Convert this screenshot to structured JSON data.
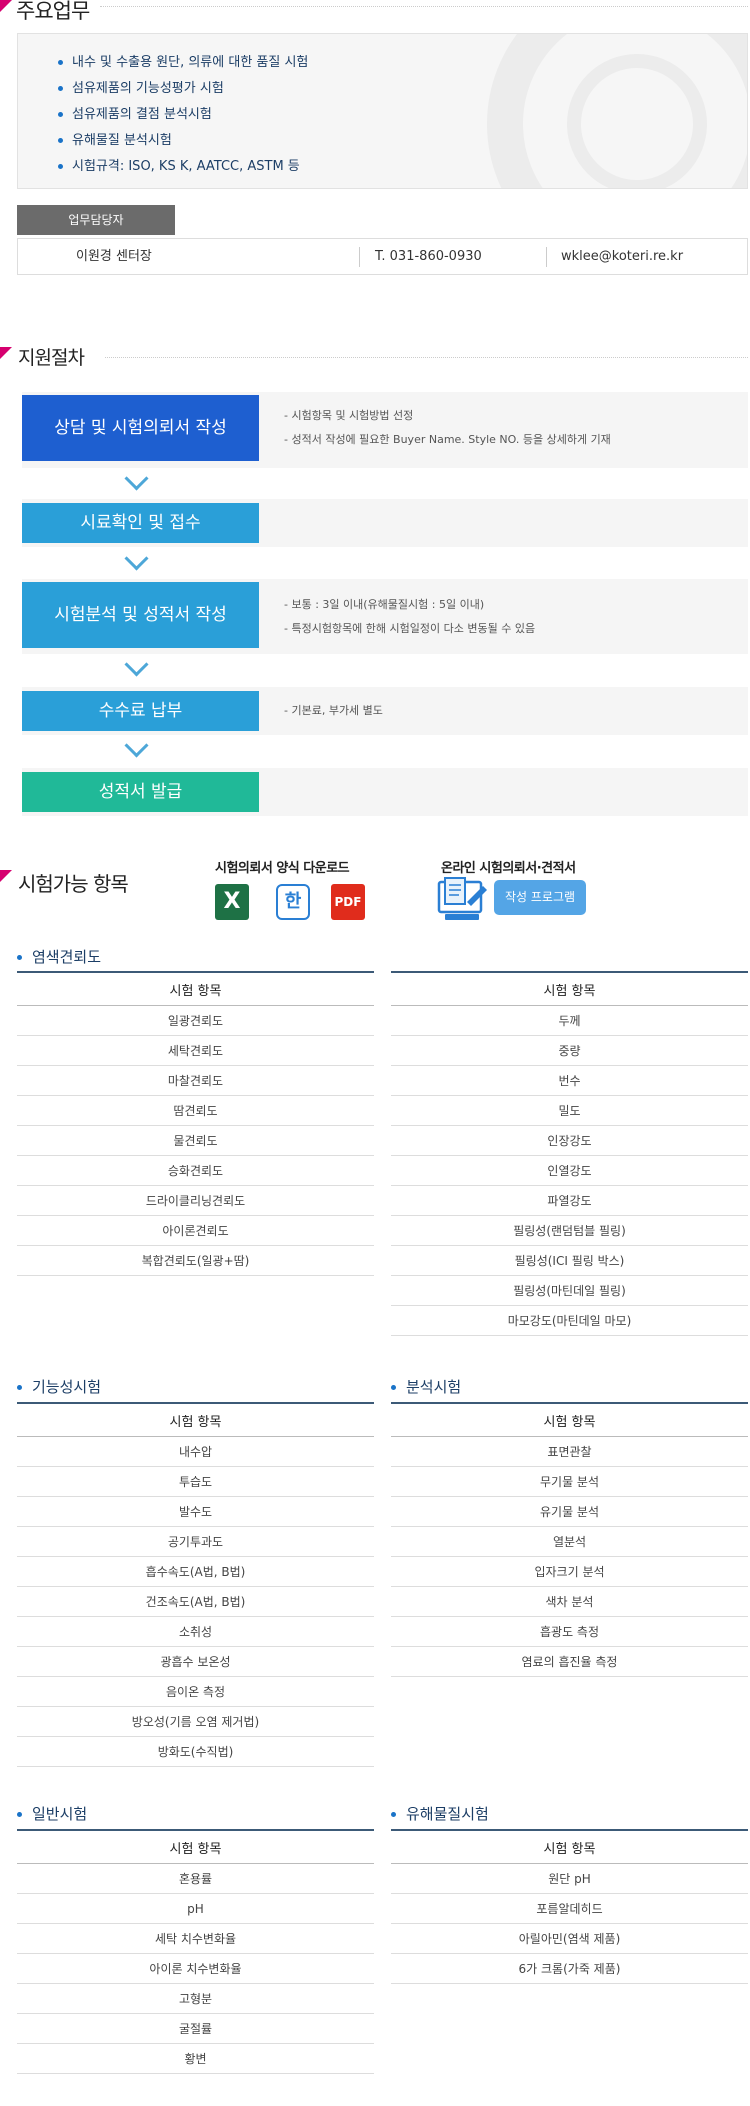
{
  "duties": {
    "title": "주요업무",
    "items": [
      "내수 및 수출용 원단, 의류에 대한 품질 시험",
      "섬유제품의 기능성평가 시험",
      "섬유제품의 결점 분석시험",
      "유해물질 분석시험",
      "시험규격: ISO, KS K, AATCC, ASTM 등"
    ]
  },
  "contact": {
    "tag": "업무담당자",
    "name": "이원경 센터장",
    "phone": "T. 031-860-0930",
    "email": "wklee@koteri.re.kr"
  },
  "procedure": {
    "title": "지원절차",
    "steps": [
      {
        "label": "상담 및 시험의뢰서 작성",
        "color": "#1e5fd0",
        "desc": [
          "- 시험항목 및 시험방법 선정",
          "- 성적서 작성에 필요한 Buyer Name. Style NO. 등을 상세하게 기재"
        ]
      },
      {
        "label": "시료확인 및 접수",
        "color": "#2a9fd8",
        "desc": []
      },
      {
        "label": "시험분석 및 성적서 작성",
        "color": "#2a9fd8",
        "desc": [
          "- 보통 : 3일 이내(유해물질시험 : 5일 이내)",
          "- 특정시험항목에 한해 시험일정이 다소 변동될 수 있음"
        ]
      },
      {
        "label": "수수료 납부",
        "color": "#2a9fd8",
        "desc": [
          "- 기본료, 부가세 별도"
        ]
      },
      {
        "label": "성적서 발급",
        "color": "#20b998",
        "desc": []
      }
    ]
  },
  "available": {
    "title": "시험가능 항목",
    "download_label": "시험의뢰서 양식 다운로드",
    "online_label": "온라인 시험의뢰서·견적서",
    "program_button": "작성 프로그램",
    "icons": {
      "excel": "X",
      "hwp": "한",
      "pdf": "PDF"
    },
    "colors": {
      "excel": "#1e7145",
      "hwp": "#2a7fd4",
      "pdf": "#e02c1c"
    }
  },
  "tables": {
    "header": "시험 항목",
    "dye": {
      "title": "염색견뢰도",
      "left": [
        "일광견뢰도",
        "세탁견뢰도",
        "마찰견뢰도",
        "땀견뢰도",
        "물견뢰도",
        "승화견뢰도",
        "드라이클리닝견뢰도",
        "아이론견뢰도",
        "복합견뢰도(일광+땀)"
      ],
      "right": [
        "두께",
        "중량",
        "번수",
        "밀도",
        "인장강도",
        "인열강도",
        "파열강도",
        "필링성(랜덤텀블 필링)",
        "필링성(ICI 필링 박스)",
        "필링성(마틴데일 필링)",
        "마모강도(마틴데일 마모)"
      ]
    },
    "func": {
      "title": "기능성시험",
      "items": [
        "내수압",
        "투습도",
        "발수도",
        "공기투과도",
        "흡수속도(A법, B법)",
        "건조속도(A법, B법)",
        "소취성",
        "광흡수 보온성",
        "음이온 측정",
        "방오성(기름 오염 제거법)",
        "방화도(수직법)"
      ]
    },
    "analysis": {
      "title": "분석시험",
      "items": [
        "표면관찰",
        "무기물 분석",
        "유기물 분석",
        "열분석",
        "입자크기 분석",
        "색차 분석",
        "흡광도 측정",
        "염료의 흡진율 측정"
      ]
    },
    "general": {
      "title": "일반시험",
      "items": [
        "혼용률",
        "pH",
        "세탁 치수변화율",
        "아이론 치수변화율",
        "고형분",
        "굴절률",
        "황변"
      ]
    },
    "hazard": {
      "title": "유해물질시험",
      "items": [
        "원단 pH",
        "포름알데히드",
        "아릴아민(염색 제품)",
        "6가 크롬(가죽 제품)"
      ]
    }
  }
}
